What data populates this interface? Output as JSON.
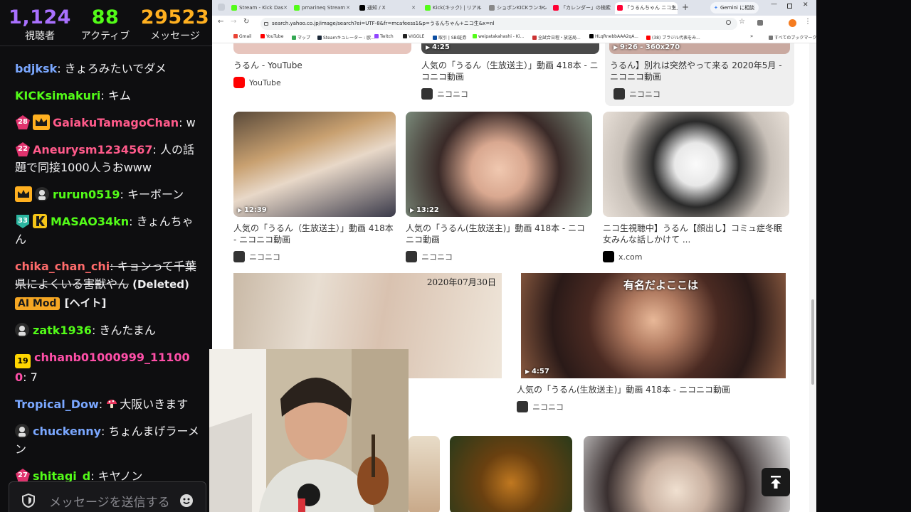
{
  "stats": {
    "viewers": {
      "value": "1,124",
      "label": "視聴者"
    },
    "active": {
      "value": "88",
      "label": "アクティブ"
    },
    "messages": {
      "value": "29523",
      "label": "メッセージ"
    }
  },
  "chat": {
    "messages": [
      {
        "user": "bdjksk",
        "color": "#7aa7ff",
        "text": ": きょろみたいでダメ"
      },
      {
        "user": "KICKsimakuri",
        "color": "#53fc18",
        "text": ": キム"
      },
      {
        "user": "GaiakuTamagoChan",
        "color": "#ff5a8a",
        "text": ": w",
        "sub": "28"
      },
      {
        "user": "Aneurysm1234567",
        "color": "#ff5a8a",
        "text": ": 人の話題で同接1000人うおwww",
        "sub": "22"
      },
      {
        "user": "rurun0519",
        "color": "#53fc18",
        "text": ": キーボーン"
      },
      {
        "user": "MASAO34kn",
        "color": "#53fc18",
        "text": ": きょんちゃん",
        "sub": "33"
      },
      {
        "user": "chika_chan_chi",
        "color": "#ff6b6b",
        "text": ": キョンって千葉県によくいる害獣や",
        "extra": "ん",
        "deleted": "(Deleted)",
        "mod": "AI Mod",
        "tag": "[ヘイト]"
      },
      {
        "user": "zatk1936",
        "color": "#53fc18",
        "text": ": きんたまん"
      },
      {
        "user": "chhanb01000999_111000",
        "color": "#ff4fa8",
        "text": ": 7",
        "level": "19"
      },
      {
        "user": "Tropical_Dow",
        "color": "#7aa7ff",
        "text": ": 大阪いきます"
      },
      {
        "user": "chuckenny",
        "color": "#7aa7ff",
        "text": ": ちょんまげラーメン"
      },
      {
        "user": "shitagi_d",
        "color": "#53fc18",
        "text": ": キヤノン",
        "sub": "27"
      }
    ],
    "input_placeholder": "メッセージを送信する"
  },
  "browser": {
    "tabs": [
      {
        "label": "Stream - Kick Das",
        "color": "#53fc18"
      },
      {
        "label": "pmarineq Stream",
        "color": "#53fc18"
      },
      {
        "label": "通知 / X",
        "color": "#000000"
      },
      {
        "label": "Kick(キック) | リアル",
        "color": "#53fc18"
      },
      {
        "label": "ショボンKICKランキン",
        "color": "#888888"
      },
      {
        "label": "「カレンダー」の検索結",
        "color": "#ff0033"
      },
      {
        "label": "「うるんちゃん ニコ生」",
        "color": "#ff0033"
      }
    ],
    "gemini": "Gemini に相談",
    "url": "search.yahoo.co.jp/image/search?ei=UTF-8&fr=mcafeess1&p=うるんちゃん+ニコ生&x=nl",
    "bookmarks": [
      "Gmail",
      "YouTube",
      "マップ",
      "Steamキュレーター : 欧...",
      "Twitch",
      "VIGGLE",
      "取引 | SBI証券",
      "weipatakahashi - Ki...",
      "全試合日程・放送局...",
      "HLqRnebbAAA2qA...",
      "(38) ブラジル代表をみ...",
      "すべてのブックマーク"
    ],
    "results": {
      "r1": {
        "title": "うるん - YouTube",
        "source": "YouTube"
      },
      "r2": {
        "title": "人気の「うるん（生放送主）」動画 418本 - ニコニコ動画",
        "source": "ニコニコ",
        "duration": "4:25"
      },
      "r3": {
        "title": "うるん】別れは突然やって来る 2020年5月 - ニコニコ動画",
        "source": "ニコニコ",
        "duration": "9:26 - 360x270"
      },
      "r4": {
        "title": "人気の「うるん（生放送主）」動画 418本 - ニコニコ動画",
        "source": "ニコニコ",
        "duration": "12:39"
      },
      "r5": {
        "title": "人気の「うるん(生放送主)」動画 418本 - ニコニコ動画",
        "source": "ニコニコ",
        "duration": "13:22"
      },
      "r6": {
        "title": "ニコ生視聴中】うるん【顔出し】コミュ症冬眠女みんな話しかけて ...",
        "source": "x.com"
      },
      "r7": {
        "date": "2020年07月30日"
      },
      "r8": {
        "title": "人気の「うるん(生放送主)」動画 418本 - ニコニコ動画",
        "source": "ニコニコ",
        "duration": "4:57",
        "caption": "有名だよここは"
      }
    }
  }
}
